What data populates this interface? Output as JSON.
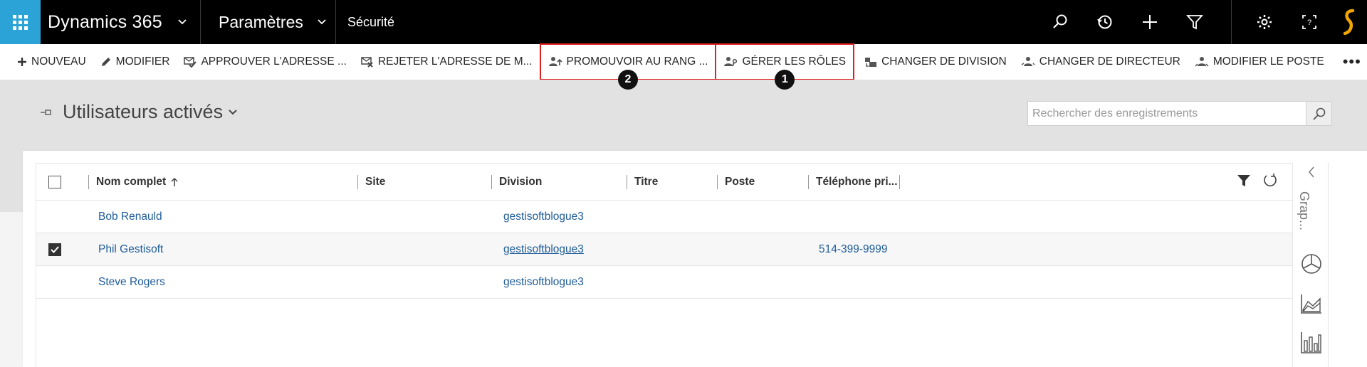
{
  "topnav": {
    "app_name": "Dynamics 365",
    "area": "Paramètres",
    "breadcrumb": "Sécurité",
    "icons": [
      "waffle-icon",
      "search-icon",
      "history-icon",
      "plus-icon",
      "filter-icon",
      "gear-icon",
      "help-icon",
      "user-logo-icon"
    ]
  },
  "cmdbar": {
    "new": "NOUVEAU",
    "edit": "MODIFIER",
    "approve": "APPROUVER L'ADRESSE ...",
    "reject": "REJETER L'ADRESSE DE M...",
    "promote": "PROMOUVOIR AU RANG ...",
    "manage_roles": "GÉRER LES RÔLES",
    "change_division": "CHANGER DE DIVISION",
    "change_manager": "CHANGER DE DIRECTEUR",
    "change_position": "MODIFIER LE POSTE",
    "more": "•••",
    "badge_manage_roles": "1",
    "badge_promote": "2",
    "highlight_color": "#e02020"
  },
  "view": {
    "title": "Utilisateurs activés",
    "search_placeholder": "Rechercher des enregistrements"
  },
  "grid": {
    "columns": [
      "Nom complet",
      "Site",
      "Division",
      "Titre",
      "Poste",
      "Téléphone pri..."
    ],
    "rows": [
      {
        "name": "Bob Renauld",
        "site": "",
        "division": "gestisoftblogue3",
        "title": "",
        "position": "",
        "phone": "",
        "checked": false
      },
      {
        "name": "Phil Gestisoft",
        "site": "",
        "division": "gestisoftblogue3",
        "title": "",
        "position": "",
        "phone": "514-399-9999",
        "checked": true
      },
      {
        "name": "Steve Rogers",
        "site": "",
        "division": "gestisoftblogue3",
        "title": "",
        "position": "",
        "phone": "",
        "checked": false
      }
    ]
  },
  "side_pane": {
    "label": "Grap..."
  },
  "colors": {
    "accent": "#2ba3d6",
    "link": "#1f5c99",
    "topbar": "#000000",
    "logo": "#f0a500"
  }
}
